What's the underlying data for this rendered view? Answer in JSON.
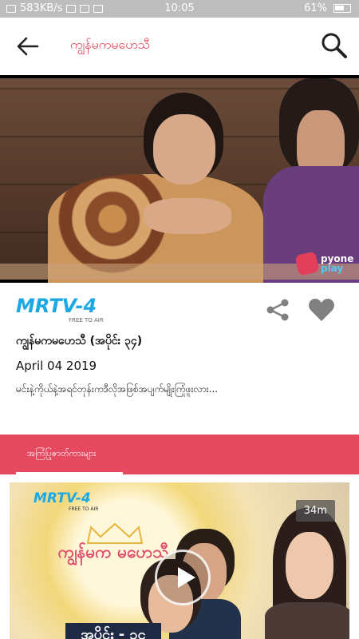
{
  "status_bar": {
    "speed": "583KB/s",
    "time": "10:05",
    "battery": "61%"
  },
  "app_bar": {
    "title": "ကျွန်မကမဟေသီ"
  },
  "video": {
    "watermark_line1": "pyone",
    "watermark_line2": "play"
  },
  "channel": {
    "name": "MRTV-4",
    "tagline": "FREE TO AIR"
  },
  "episode": {
    "title": "ကျွန်မကမဟေသီ (အပိုင်း ၃၄)",
    "date": "April 04 2019",
    "description": "မင်းနဲ့ကိုယ်နဲ့အရင်တုန်းကဒီလိုအဖြစ်အပျက်မျိုးကြုံဖူးလား..."
  },
  "tabs": [
    {
      "label": "အကြံပြုဇာတ်ကားများ",
      "active": true
    }
  ],
  "thumbnail": {
    "channel_logo": "MRTV-4",
    "channel_tagline": "FREE TO AIR",
    "show_title": "ကျွန်မက မဟေသီ",
    "episode_band": "အပိုင်း - ၃၄",
    "duration": "34m"
  },
  "colors": {
    "accent": "#e64a60",
    "title_red": "#e53950",
    "brand_blue": "#1ba8e4",
    "icon_gray": "#808080"
  }
}
